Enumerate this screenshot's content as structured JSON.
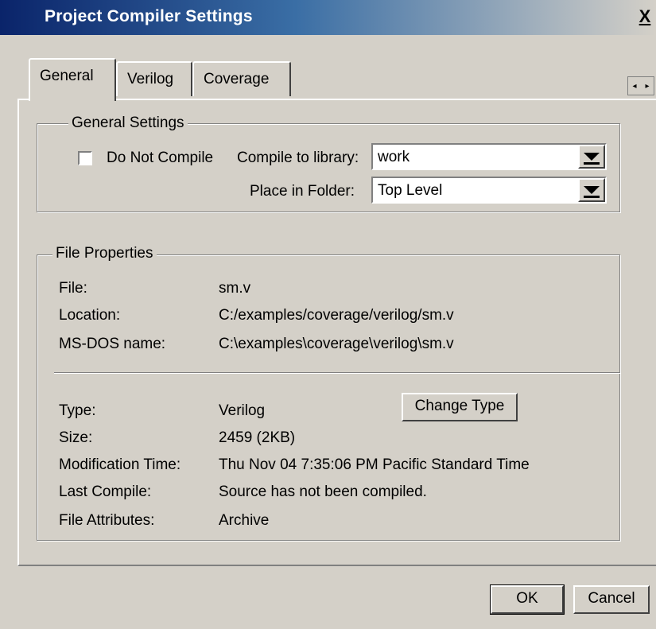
{
  "window": {
    "title": "Project Compiler Settings",
    "close_glyph": "X"
  },
  "tabs": [
    {
      "label": "General",
      "active": true
    },
    {
      "label": "Verilog",
      "active": false
    },
    {
      "label": "Coverage",
      "active": false
    }
  ],
  "tab_scroll": {
    "left": "◂",
    "right": "▸"
  },
  "general_settings": {
    "legend": "General Settings",
    "do_not_compile_label": "Do Not Compile",
    "do_not_compile_checked": false,
    "compile_to_library_label": "Compile to library:",
    "compile_to_library_value": "work",
    "place_in_folder_label": "Place in Folder:",
    "place_in_folder_value": "Top Level"
  },
  "file_properties": {
    "legend": "File Properties",
    "file_label": "File:",
    "file_value": "sm.v",
    "location_label": "Location:",
    "location_value": "C:/examples/coverage/verilog/sm.v",
    "msdos_label": "MS-DOS name:",
    "msdos_value": "C:\\examples\\coverage\\verilog\\sm.v",
    "type_label": "Type:",
    "type_value": "Verilog",
    "change_type_label": "Change Type",
    "size_label": "Size:",
    "size_value": "2459 (2KB)",
    "modtime_label": "Modification Time:",
    "modtime_value": "Thu Nov 04 7:35:06 PM Pacific Standard Time",
    "last_compile_label": "Last Compile:",
    "last_compile_value": "Source has not been compiled.",
    "attributes_label": "File Attributes:",
    "attributes_value": "Archive"
  },
  "buttons": {
    "ok": "OK",
    "cancel": "Cancel"
  }
}
